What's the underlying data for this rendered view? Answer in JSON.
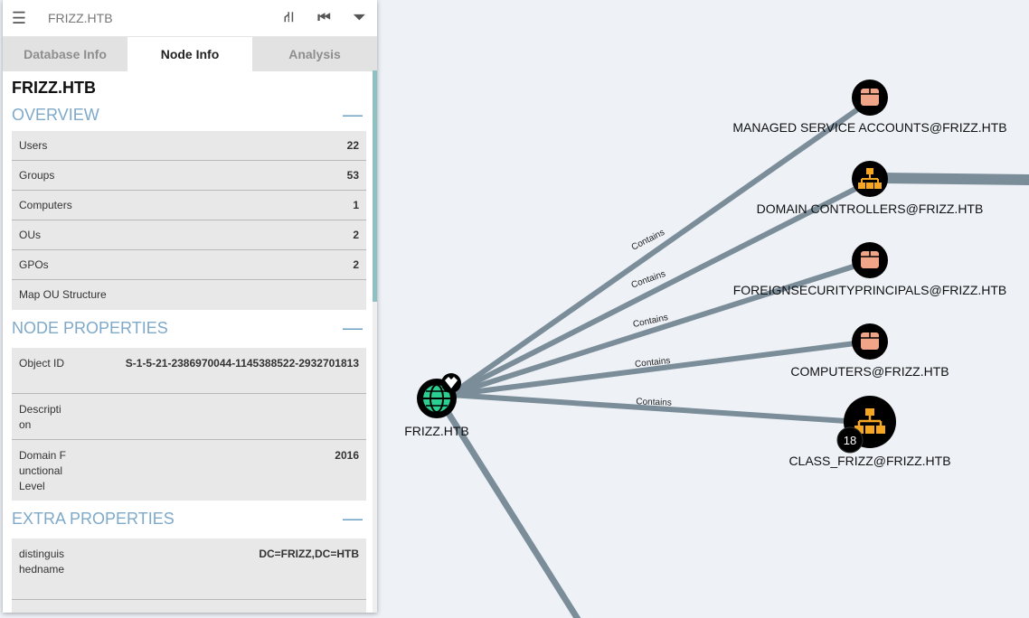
{
  "header": {
    "search_title": "FRIZZ.HTB",
    "menu_icon": "hamburger-icon",
    "tools": [
      "pathfinding-icon",
      "back-icon",
      "filter-icon"
    ]
  },
  "tabs": [
    {
      "label": "Database Info",
      "active": false
    },
    {
      "label": "Node Info",
      "active": true
    },
    {
      "label": "Analysis",
      "active": false
    }
  ],
  "node": {
    "name": "FRIZZ.HTB",
    "overview": {
      "title": "OVERVIEW",
      "toggle": "—",
      "rows": [
        {
          "label": "Users",
          "value": "22"
        },
        {
          "label": "Groups",
          "value": "53"
        },
        {
          "label": "Computers",
          "value": "1"
        },
        {
          "label": "OUs",
          "value": "2"
        },
        {
          "label": "GPOs",
          "value": "2"
        },
        {
          "label": "Map OU Structure",
          "value": ""
        }
      ]
    },
    "node_properties": {
      "title": "NODE PROPERTIES",
      "toggle": "—",
      "rows": [
        {
          "label": "Object ID",
          "value": "S-1-5-21-2386970044-1145388522-2932701813"
        },
        {
          "label": "Description",
          "value": ""
        },
        {
          "label": "Domain Functional Level",
          "value": "2016"
        }
      ]
    },
    "extra_properties": {
      "title": "EXTRA PROPERTIES",
      "toggle": "—",
      "rows": [
        {
          "label": "distinguishedname",
          "value": "DC=FRIZZ,DC=HTB"
        }
      ]
    }
  },
  "graph": {
    "center": {
      "label": "FRIZZ.HTB",
      "icon": "globe-icon",
      "badge_icon": "crown-icon"
    },
    "edge_label": "Contains",
    "targets": [
      {
        "label": "MANAGED SERVICE ACCOUNTS@FRIZZ.HTB",
        "icon": "container-icon"
      },
      {
        "label": "DOMAIN CONTROLLERS@FRIZZ.HTB",
        "icon": "ou-icon"
      },
      {
        "label": "FOREIGNSECURITYPRINCIPALS@FRIZZ.HTB",
        "icon": "container-icon"
      },
      {
        "label": "COMPUTERS@FRIZZ.HTB",
        "icon": "container-icon"
      },
      {
        "label": "CLASS_FRIZZ@FRIZZ.HTB",
        "icon": "ou-icon",
        "badge": "18"
      }
    ]
  },
  "colors": {
    "edge": "#7b8d99",
    "container": "#f0a488",
    "ou": "#f5a623",
    "domain": "#2ccf92",
    "accent": "#7ea9c9"
  }
}
